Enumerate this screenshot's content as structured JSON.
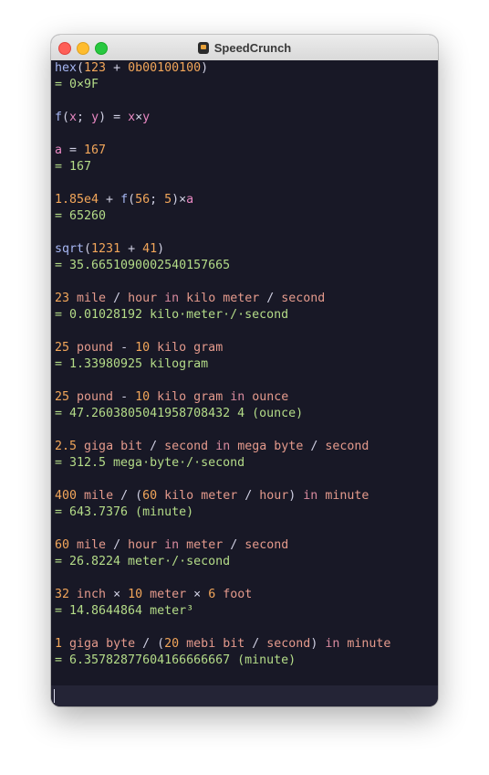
{
  "window": {
    "title": "SpeedCrunch",
    "app_icon": "speedcrunch-app-icon"
  },
  "colors": {
    "background": "#181826",
    "editor_background": "#242436",
    "default": "#cfcfe2",
    "number": "#f2a65a",
    "function": "#a6b6f2",
    "variable": "#e888c2",
    "unit": "#e49a8c",
    "keyword": "#d88a9e",
    "result": "#b4dc88",
    "operator": "#cfcfe2"
  },
  "history": [
    {
      "expression": [
        [
          "function",
          "hex"
        ],
        [
          "default",
          "("
        ],
        [
          "number",
          "123"
        ],
        [
          "default",
          " + "
        ],
        [
          "number",
          "0b00100100"
        ],
        [
          "default",
          ")"
        ]
      ],
      "result": "= 0×9F"
    },
    {
      "expression": [
        [
          "function",
          "f"
        ],
        [
          "default",
          "("
        ],
        [
          "variable",
          "x"
        ],
        [
          "default",
          "; "
        ],
        [
          "variable",
          "y"
        ],
        [
          "default",
          ") = "
        ],
        [
          "variable",
          "x"
        ],
        [
          "default",
          "×"
        ],
        [
          "variable",
          "y"
        ]
      ],
      "result": null
    },
    {
      "expression": [
        [
          "variable",
          "a"
        ],
        [
          "default",
          " = "
        ],
        [
          "number",
          "167"
        ]
      ],
      "result": "= 167"
    },
    {
      "expression": [
        [
          "number",
          "1.85e4"
        ],
        [
          "default",
          " + "
        ],
        [
          "function",
          "f"
        ],
        [
          "default",
          "("
        ],
        [
          "number",
          "56"
        ],
        [
          "default",
          "; "
        ],
        [
          "number",
          "5"
        ],
        [
          "default",
          ")×"
        ],
        [
          "variable",
          "a"
        ]
      ],
      "result": "= 65260"
    },
    {
      "expression": [
        [
          "function",
          "sqrt"
        ],
        [
          "default",
          "("
        ],
        [
          "number",
          "1231"
        ],
        [
          "default",
          " + "
        ],
        [
          "number",
          "41"
        ],
        [
          "default",
          ")"
        ]
      ],
      "result": "= 35.6651090002540157665"
    },
    {
      "expression": [
        [
          "number",
          "23"
        ],
        [
          "default",
          " "
        ],
        [
          "unit",
          "mile"
        ],
        [
          "default",
          " / "
        ],
        [
          "unit",
          "hour"
        ],
        [
          "default",
          " "
        ],
        [
          "keyword",
          "in"
        ],
        [
          "default",
          " "
        ],
        [
          "unit",
          "kilo"
        ],
        [
          "default",
          " "
        ],
        [
          "unit",
          "meter"
        ],
        [
          "default",
          " / "
        ],
        [
          "unit",
          "second"
        ]
      ],
      "result": "= 0.01028192 kilo·meter·/·second"
    },
    {
      "expression": [
        [
          "number",
          "25"
        ],
        [
          "default",
          " "
        ],
        [
          "unit",
          "pound"
        ],
        [
          "default",
          " - "
        ],
        [
          "number",
          "10"
        ],
        [
          "default",
          " "
        ],
        [
          "unit",
          "kilo"
        ],
        [
          "default",
          " "
        ],
        [
          "unit",
          "gram"
        ]
      ],
      "result": "= 1.33980925 kilogram"
    },
    {
      "expression": [
        [
          "number",
          "25"
        ],
        [
          "default",
          " "
        ],
        [
          "unit",
          "pound"
        ],
        [
          "default",
          " - "
        ],
        [
          "number",
          "10"
        ],
        [
          "default",
          " "
        ],
        [
          "unit",
          "kilo"
        ],
        [
          "default",
          " "
        ],
        [
          "unit",
          "gram"
        ],
        [
          "default",
          " "
        ],
        [
          "keyword",
          "in"
        ],
        [
          "default",
          " "
        ],
        [
          "unit",
          "ounce"
        ]
      ],
      "result": "= 47.2603805041958708432 4 (ounce)"
    },
    {
      "expression": [
        [
          "number",
          "2.5"
        ],
        [
          "default",
          " "
        ],
        [
          "unit",
          "giga"
        ],
        [
          "default",
          " "
        ],
        [
          "unit",
          "bit"
        ],
        [
          "default",
          " / "
        ],
        [
          "unit",
          "second"
        ],
        [
          "default",
          " "
        ],
        [
          "keyword",
          "in"
        ],
        [
          "default",
          " "
        ],
        [
          "unit",
          "mega"
        ],
        [
          "default",
          " "
        ],
        [
          "unit",
          "byte"
        ],
        [
          "default",
          " / "
        ],
        [
          "unit",
          "second"
        ]
      ],
      "result": "= 312.5 mega·byte·/·second"
    },
    {
      "expression": [
        [
          "number",
          "400"
        ],
        [
          "default",
          " "
        ],
        [
          "unit",
          "mile"
        ],
        [
          "default",
          " / ("
        ],
        [
          "number",
          "60"
        ],
        [
          "default",
          " "
        ],
        [
          "unit",
          "kilo"
        ],
        [
          "default",
          " "
        ],
        [
          "unit",
          "meter"
        ],
        [
          "default",
          " / "
        ],
        [
          "unit",
          "hour"
        ],
        [
          "default",
          ") "
        ],
        [
          "keyword",
          "in"
        ],
        [
          "default",
          " "
        ],
        [
          "unit",
          "minute"
        ]
      ],
      "result": "= 643.7376 (minute)"
    },
    {
      "expression": [
        [
          "number",
          "60"
        ],
        [
          "default",
          " "
        ],
        [
          "unit",
          "mile"
        ],
        [
          "default",
          " / "
        ],
        [
          "unit",
          "hour"
        ],
        [
          "default",
          " "
        ],
        [
          "keyword",
          "in"
        ],
        [
          "default",
          " "
        ],
        [
          "unit",
          "meter"
        ],
        [
          "default",
          " / "
        ],
        [
          "unit",
          "second"
        ]
      ],
      "result": "= 26.8224 meter·/·second"
    },
    {
      "expression": [
        [
          "number",
          "32"
        ],
        [
          "default",
          " "
        ],
        [
          "unit",
          "inch"
        ],
        [
          "default",
          " × "
        ],
        [
          "number",
          "10"
        ],
        [
          "default",
          " "
        ],
        [
          "unit",
          "meter"
        ],
        [
          "default",
          " × "
        ],
        [
          "number",
          "6"
        ],
        [
          "default",
          " "
        ],
        [
          "unit",
          "foot"
        ]
      ],
      "result": "= 14.8644864 meter³"
    },
    {
      "expression": [
        [
          "number",
          "1"
        ],
        [
          "default",
          " "
        ],
        [
          "unit",
          "giga"
        ],
        [
          "default",
          " "
        ],
        [
          "unit",
          "byte"
        ],
        [
          "default",
          " / ("
        ],
        [
          "number",
          "20"
        ],
        [
          "default",
          " "
        ],
        [
          "unit",
          "mebi"
        ],
        [
          "default",
          " "
        ],
        [
          "unit",
          "bit"
        ],
        [
          "default",
          " / "
        ],
        [
          "unit",
          "second"
        ],
        [
          "default",
          ") "
        ],
        [
          "keyword",
          "in"
        ],
        [
          "default",
          " "
        ],
        [
          "unit",
          "minute"
        ]
      ],
      "result": "= 6.35782877604166666667 (minute)"
    }
  ],
  "editor": {
    "value": ""
  }
}
